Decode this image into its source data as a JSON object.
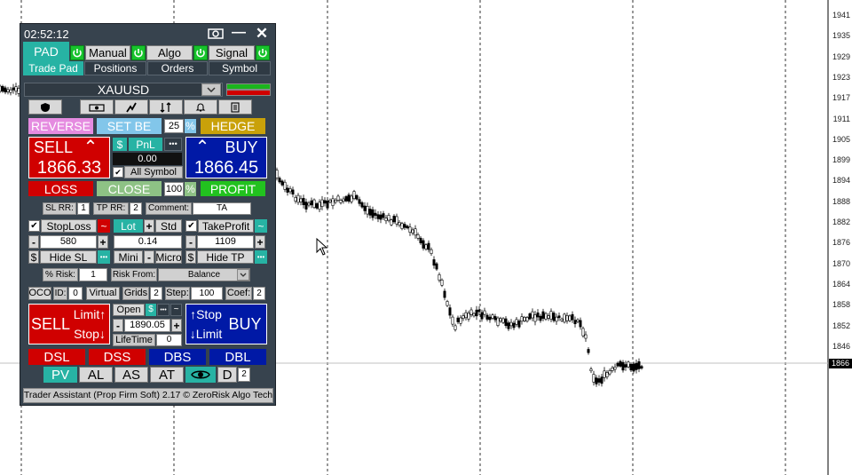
{
  "chart": {
    "price_ticks": [
      "1941",
      "1935",
      "1929",
      "1923",
      "1917",
      "1911",
      "1905",
      "1899",
      "1894",
      "1888",
      "1882",
      "1876",
      "1870",
      "1864",
      "1858",
      "1852",
      "1846"
    ],
    "current_price": "1866",
    "colors": {
      "candle": "#000000",
      "grid": "#000000",
      "price_line": "#c0c0c0"
    }
  },
  "panel": {
    "time": "02:52:12",
    "modes": {
      "pad": "PAD",
      "manual": "Manual",
      "algo": "Algo",
      "signal": "Signal"
    },
    "tabs": {
      "trade_pad": "Trade Pad",
      "positions": "Positions",
      "orders": "Orders",
      "symbol": "Symbol"
    },
    "symbol": "XAUUSD",
    "reverse": "REVERSE",
    "set_be": "SET BE",
    "be_value": "25",
    "percent": "%",
    "hedge": "HEDGE",
    "sell_label": "SELL",
    "sell_price": "1866.33",
    "buy_label": "BUY",
    "buy_price": "1866.45",
    "dollar": "$",
    "pnl": "PnL",
    "dots": "•••",
    "pnl_value": "0.00",
    "all_symbol": "All Symbol",
    "loss": "LOSS",
    "close": "CLOSE",
    "close_value": "100",
    "profit": "PROFIT",
    "sl_rr_label": "SL RR:",
    "sl_rr_value": "1",
    "tp_rr_label": "TP RR:",
    "tp_rr_value": "2",
    "comment_label": "Comment:",
    "comment_value": "TA",
    "stoploss": "StopLoss",
    "tilde": "~",
    "lot": "Lot",
    "plus": "+",
    "minus": "-",
    "std": "Std",
    "takeprofit": "TakeProfit",
    "sl_value": "580",
    "lot_value": "0.14",
    "tp_value": "1109",
    "hide_sl": "Hide SL",
    "mini": "Mini",
    "micro": "Micro",
    "hide_tp": "Hide TP",
    "risk_label": "% Risk:",
    "risk_value": "1",
    "risk_from_label": "Risk From:",
    "risk_from_value": "Balance",
    "oco": "OCO",
    "id_label": "ID:",
    "id_value": "0",
    "virtual": "Virtual",
    "grids_label": "Grids",
    "grids_value": "2",
    "step_label": "Step:",
    "step_value": "100",
    "coef_label": "Coef:",
    "coef_value": "2",
    "pend_sell": "SELL",
    "limit_up": "Limit↑",
    "stop_down": "Stop↓",
    "open": "Open",
    "open_price": "1890.05",
    "lifetime_label": "LifeTime",
    "lifetime_value": "0",
    "stop_up": "↑Stop",
    "limit_down": "↓Limit",
    "pend_buy": "BUY",
    "dsl": "DSL",
    "dss": "DSS",
    "dbs": "DBS",
    "dbl": "DBL",
    "pv": "PV",
    "al": "AL",
    "as": "AS",
    "at": "AT",
    "d_label": "D",
    "d_value": "2",
    "footer": "Trader Assistant (Prop Firm Soft) 2.17 © ZeroRisk Algo Tech"
  }
}
